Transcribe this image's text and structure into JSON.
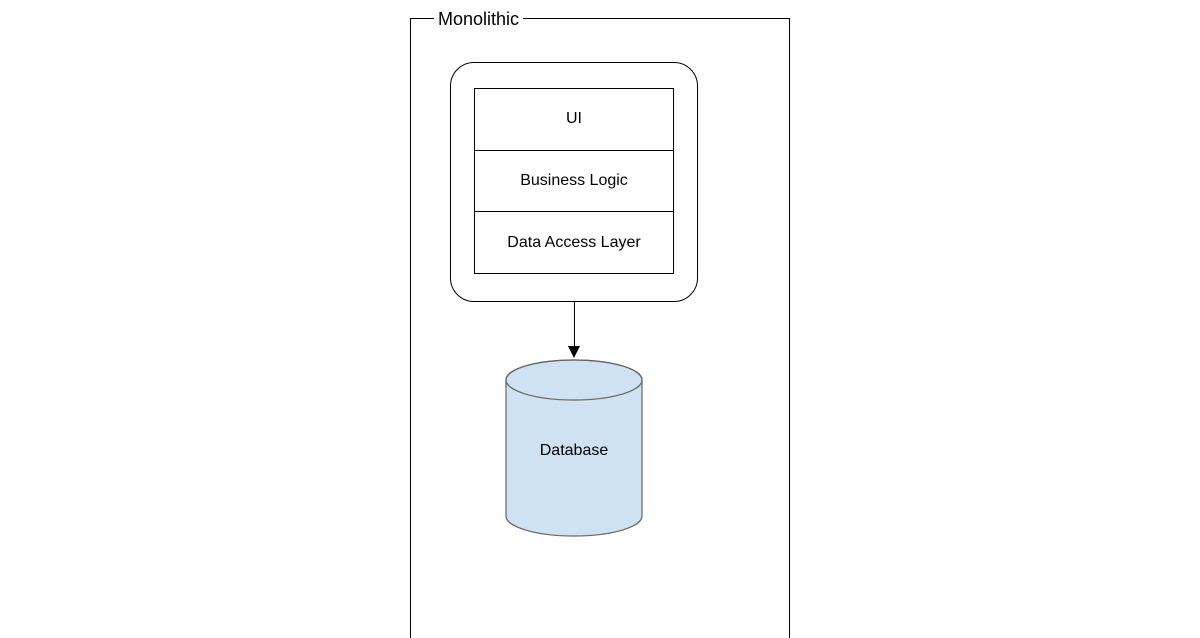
{
  "diagram": {
    "frame_title": "Monolithic",
    "layers": [
      "UI",
      "Business Logic",
      "Data Access Layer"
    ],
    "database_label": "Database",
    "colors": {
      "db_fill": "#cfe2f3",
      "db_stroke": "#666"
    }
  }
}
